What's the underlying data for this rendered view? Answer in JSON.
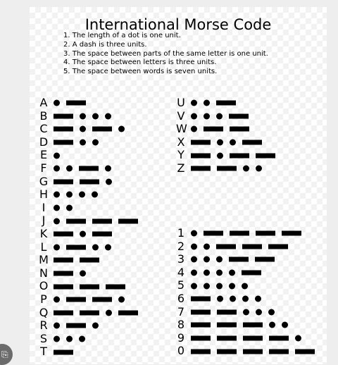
{
  "title": "International Morse Code",
  "rules": [
    "1. The length of a dot is one unit.",
    "2. A dash is three units.",
    "3. The space between parts of the same letter is one unit.",
    "4. The space between letters is three units.",
    "5. The space between words is seven units."
  ],
  "columns": {
    "letters_a_t": [
      {
        "char": "A",
        "code": ".-"
      },
      {
        "char": "B",
        "code": "-..."
      },
      {
        "char": "C",
        "code": "-.-."
      },
      {
        "char": "D",
        "code": "-.."
      },
      {
        "char": "E",
        "code": "."
      },
      {
        "char": "F",
        "code": "..-."
      },
      {
        "char": "G",
        "code": "--."
      },
      {
        "char": "H",
        "code": "...."
      },
      {
        "char": "I",
        "code": ".."
      },
      {
        "char": "J",
        "code": ".---"
      },
      {
        "char": "K",
        "code": "-.-"
      },
      {
        "char": "L",
        "code": ".-.."
      },
      {
        "char": "M",
        "code": "--"
      },
      {
        "char": "N",
        "code": "-."
      },
      {
        "char": "O",
        "code": "---"
      },
      {
        "char": "P",
        "code": ".--."
      },
      {
        "char": "Q",
        "code": "--.-"
      },
      {
        "char": "R",
        "code": ".-."
      },
      {
        "char": "S",
        "code": "..."
      },
      {
        "char": "T",
        "code": "-"
      }
    ],
    "letters_u_z": [
      {
        "char": "U",
        "code": "..-"
      },
      {
        "char": "V",
        "code": "...-"
      },
      {
        "char": "W",
        "code": ".--"
      },
      {
        "char": "X",
        "code": "-..-"
      },
      {
        "char": "Y",
        "code": "-.--"
      },
      {
        "char": "Z",
        "code": "--.."
      }
    ],
    "digits": [
      {
        "char": "1",
        "code": ".----"
      },
      {
        "char": "2",
        "code": "..---"
      },
      {
        "char": "3",
        "code": "...--"
      },
      {
        "char": "4",
        "code": "....-"
      },
      {
        "char": "5",
        "code": "....."
      },
      {
        "char": "6",
        "code": "-...."
      },
      {
        "char": "7",
        "code": "--..."
      },
      {
        "char": "8",
        "code": "---.."
      },
      {
        "char": "9",
        "code": "----."
      },
      {
        "char": "0",
        "code": "-----"
      }
    ]
  },
  "colors": {
    "page_background": "#eeeeee",
    "sheet": "#ffffff",
    "ink": "#000000",
    "badge": "#6b6b6b"
  },
  "icons": {
    "corner_badge": "share-icon"
  }
}
